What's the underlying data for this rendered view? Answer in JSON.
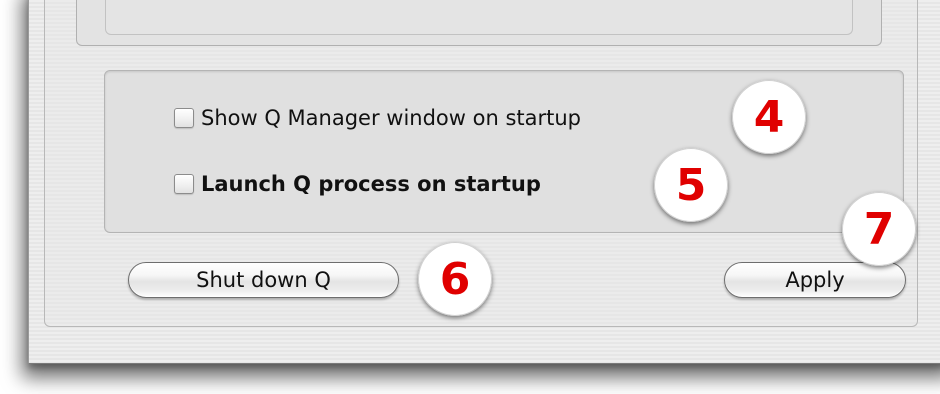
{
  "options": {
    "show_manager_label": "Show Q Manager window on startup",
    "show_manager_checked": false,
    "launch_process_label": "Launch Q process on startup",
    "launch_process_checked": false
  },
  "buttons": {
    "shutdown_label": "Shut down Q",
    "apply_label": "Apply"
  },
  "callouts": {
    "c4": "4",
    "c5": "5",
    "c6": "6",
    "c7": "7"
  },
  "colors": {
    "callout_number": "#e00000",
    "window_bg": "#ececec"
  }
}
